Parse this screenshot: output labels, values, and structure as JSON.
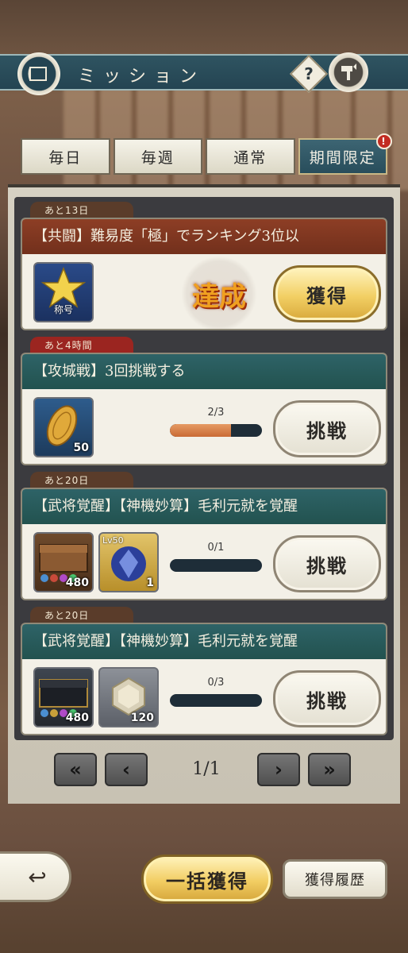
{
  "header": {
    "title": "ミッション",
    "help_label": "?"
  },
  "tabs": [
    {
      "label": "毎日"
    },
    {
      "label": "毎週"
    },
    {
      "label": "通常"
    },
    {
      "label": "期間限定",
      "badge": "!"
    }
  ],
  "missions": [
    {
      "timer": "あと13日",
      "title": "【共闘】難易度「極」でランキング3位以",
      "reward": {
        "caption": "称号"
      },
      "stamp": "達成",
      "button": "獲得"
    },
    {
      "timer": "あと4時間",
      "title": "【攻城戦】3回挑戦する",
      "reward": {
        "qty": "50"
      },
      "progress_text": "2/3",
      "progress": 0.6667,
      "button": "挑戦"
    },
    {
      "timer": "あと20日",
      "title": "【武将覚醒】【神機妙算】毛利元就を覚醒",
      "rewards": [
        {
          "qty": "480"
        },
        {
          "level": "Lv50",
          "qty": "1"
        }
      ],
      "progress_text": "0/1",
      "progress": 0,
      "button": "挑戦"
    },
    {
      "timer": "あと20日",
      "title": "【武将覚醒】【神機妙算】毛利元就を覚醒",
      "rewards": [
        {
          "qty": "480"
        },
        {
          "qty": "120"
        }
      ],
      "progress_text": "0/3",
      "progress": 0,
      "button": "挑戦"
    }
  ],
  "pager": {
    "first": "«",
    "prev": "‹",
    "next": "›",
    "last": "»",
    "page": "1/1"
  },
  "footer": {
    "back_icon": "↩",
    "bulk_claim": "一括獲得",
    "history": "獲得履歴"
  }
}
